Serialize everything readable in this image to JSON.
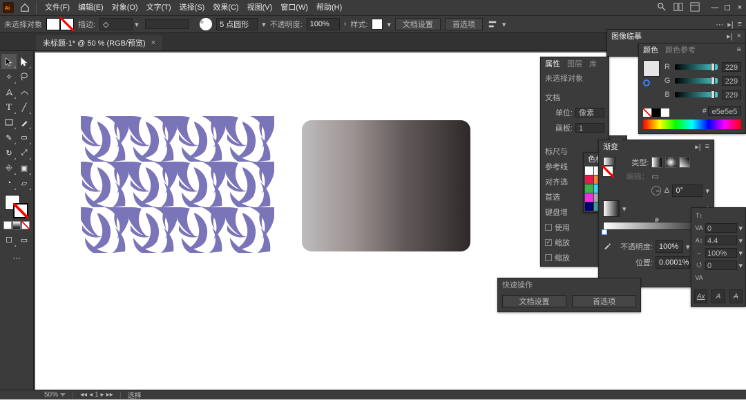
{
  "menus": [
    "文件(F)",
    "编辑(E)",
    "对象(O)",
    "文字(T)",
    "选择(S)",
    "效果(C)",
    "视图(V)",
    "窗口(W)",
    "帮助(H)"
  ],
  "ctrl": {
    "noselection": "未选择对象",
    "stroke_label": "描边:",
    "stroke_dd": "◇",
    "stroke_weight": "5 点圆形",
    "opacity_label": "不透明度:",
    "opacity_val": "100%",
    "style_label": "样式:",
    "docsetup": "文档设置",
    "prefs": "首选项"
  },
  "doc": {
    "tab": "未标题-1* @ 50 % (RGB/预览)",
    "close": "×"
  },
  "status": {
    "zoom": "50%",
    "tool": "选择"
  },
  "trace": {
    "title": "图像临摹"
  },
  "color": {
    "tab1": "颜色",
    "tab2": "颜色参考",
    "R": "229",
    "G": "229",
    "B": "229",
    "hex": "e5e5e5"
  },
  "props": {
    "tabs": [
      "属性",
      "图层",
      "库"
    ],
    "nosel": "未选择对象",
    "doc_label": "文档",
    "unit_label": "单位:",
    "unit_val": "像素",
    "artboard_label": "画板:",
    "artboard_val": "1",
    "ruler_label": "标尺与",
    "guides_label": "参考线",
    "snap_label": "对齐选",
    "pref_label": "首选",
    "key_label": "键盘增",
    "use_label": "使用",
    "scale1": "缩放",
    "scale2": "缩放"
  },
  "swatch": {
    "title": "色板"
  },
  "gradient": {
    "title": "渐变",
    "type_label": "类型:",
    "edit_label": "编辑：",
    "angle_val": "0°",
    "opacity_label": "不透明度:",
    "opacity_val": "100%",
    "location_label": "位置:",
    "location_val": "0.0001%"
  },
  "text": {
    "tracking_val": "0",
    "scale_val": "100%",
    "baseline_val": "4.4",
    "buttons": [
      "Ax",
      "A",
      "A"
    ]
  },
  "quick": {
    "title": "快速操作",
    "b1": "文档设置",
    "b2": "首选项"
  },
  "mini_collapsed": "编辑器"
}
